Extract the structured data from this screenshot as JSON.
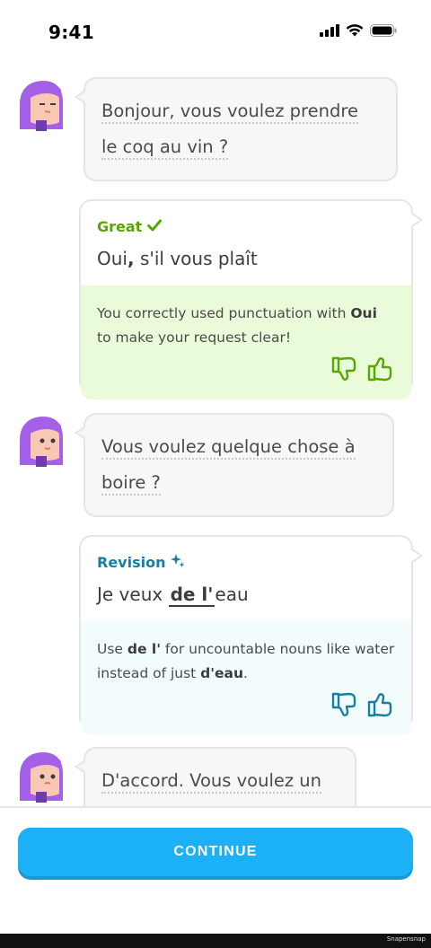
{
  "status_bar": {
    "time": "9:41",
    "icons": [
      "signal-icon",
      "wifi-icon",
      "battery-icon"
    ]
  },
  "messages": [
    {
      "speaker": "character",
      "text_parts": [
        "Bonjour, vous voulez prendre",
        "le coq au vin ?"
      ]
    },
    {
      "speaker": "user",
      "status": "Great",
      "status_icon": "check-icon",
      "answer_parts": [
        "Oui",
        ",",
        " s'il vous plaît"
      ],
      "feedback_parts": [
        "You correctly used punctuation with ",
        "Oui",
        " to make your request clear!"
      ]
    },
    {
      "speaker": "character",
      "text_parts": [
        "Vous voulez quelque chose à",
        "boire ?"
      ]
    },
    {
      "speaker": "user",
      "status": "Revision",
      "status_icon": "sparkle-icon",
      "answer_parts": [
        "Je veux ",
        "de l'",
        "eau"
      ],
      "feedback_parts": [
        "Use ",
        "de l'",
        " for uncountable nouns like water instead of just ",
        "d'eau",
        "."
      ]
    },
    {
      "speaker": "character",
      "text_parts": [
        "D'accord. Vous voulez un"
      ]
    }
  ],
  "footer": {
    "continue_label": "CONTINUE"
  },
  "watermark": "Snapensnap",
  "colors": {
    "great": "#58a700",
    "great_bg": "#e9fbd8",
    "revision": "#1580a3",
    "revision_bg": "#f2fcfd",
    "button": "#1cb0f6",
    "avatar_hair": "#a560e8"
  }
}
